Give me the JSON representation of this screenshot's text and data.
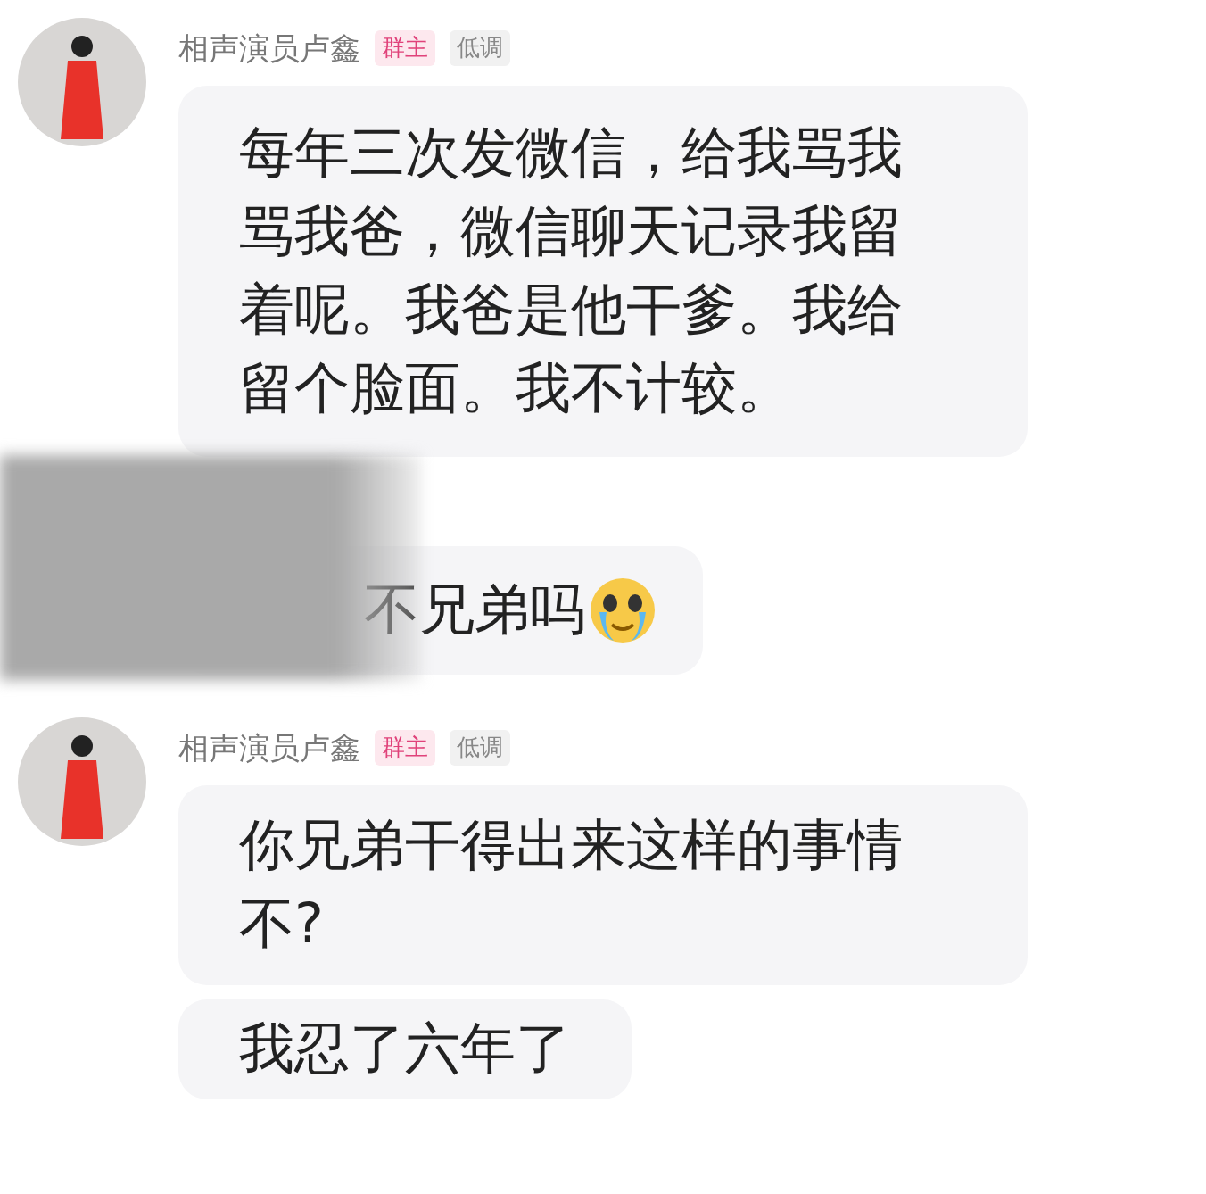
{
  "messages": [
    {
      "sender": {
        "name": "相声演员卢鑫",
        "tags": [
          {
            "label": "群主",
            "kind": "owner"
          },
          {
            "label": "低调",
            "kind": "plain"
          }
        ]
      },
      "bubbles": [
        {
          "kind": "text",
          "text": "每年三次发微信，给我骂我骂我爸，微信聊天记录我留着呢。我爸是他干爹。我给留个脸面。我不计较。"
        }
      ]
    },
    {
      "redacted": true,
      "bubbles": [
        {
          "kind": "text_emoji",
          "text": "不兄弟吗"
        }
      ]
    },
    {
      "sender": {
        "name": "相声演员卢鑫",
        "tags": [
          {
            "label": "群主",
            "kind": "owner"
          },
          {
            "label": "低调",
            "kind": "plain"
          }
        ]
      },
      "bubbles": [
        {
          "kind": "text",
          "text": "你兄弟干得出来这样的事情不?"
        },
        {
          "kind": "text",
          "text": "我忍了六年了"
        }
      ]
    }
  ]
}
